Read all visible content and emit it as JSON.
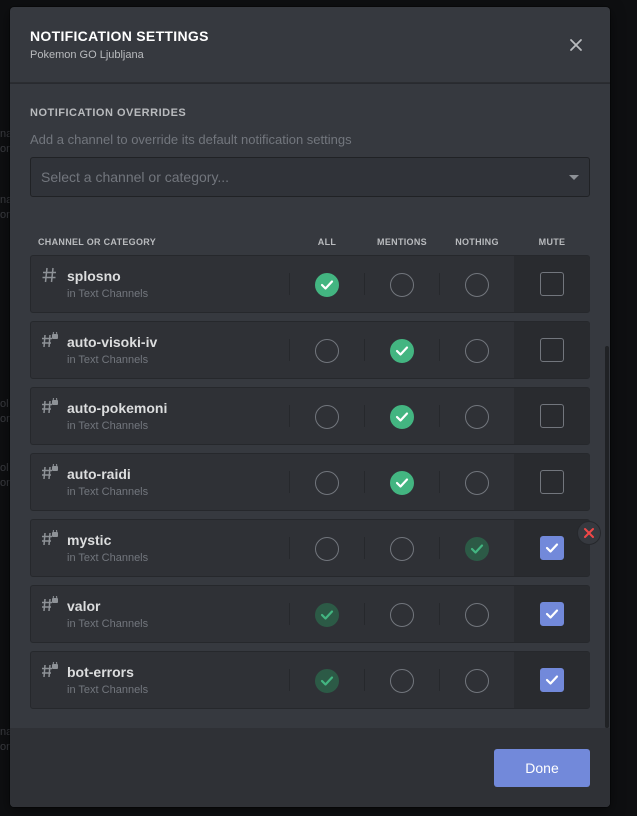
{
  "background": {
    "fragments": [
      "na",
      "on",
      "na",
      "on",
      "ol",
      "on",
      "ol",
      "on",
      "na",
      "on"
    ]
  },
  "modal": {
    "title": "NOTIFICATION SETTINGS",
    "subtitle": "Pokemon GO Ljubljana",
    "close_icon": "close-icon"
  },
  "overrides": {
    "section_title": "NOTIFICATION OVERRIDES",
    "description": "Add a channel to override its default notification settings",
    "select_placeholder": "Select a channel or category..."
  },
  "table": {
    "headers": {
      "channel": "CHANNEL OR CATEGORY",
      "all": "ALL",
      "mentions": "MENTIONS",
      "nothing": "NOTHING",
      "mute": "MUTE"
    },
    "rows": [
      {
        "name": "splosno",
        "category": "in Text Channels",
        "locked": false,
        "setting": "all",
        "muted": false
      },
      {
        "name": "auto-visoki-iv",
        "category": "in Text Channels",
        "locked": true,
        "setting": "mentions",
        "muted": false
      },
      {
        "name": "auto-pokemoni",
        "category": "in Text Channels",
        "locked": true,
        "setting": "mentions",
        "muted": false
      },
      {
        "name": "auto-raidi",
        "category": "in Text Channels",
        "locked": true,
        "setting": "mentions",
        "muted": false
      },
      {
        "name": "mystic",
        "category": "in Text Channels",
        "locked": true,
        "setting": "nothing",
        "muted": true
      },
      {
        "name": "valor",
        "category": "in Text Channels",
        "locked": true,
        "setting": "all",
        "muted": true
      },
      {
        "name": "bot-errors",
        "category": "in Text Channels",
        "locked": true,
        "setting": "all",
        "muted": true
      }
    ]
  },
  "colors": {
    "green": "#43b581",
    "green_dim": "#2c5a46",
    "blurple": "#7289da",
    "red": "#f04747"
  },
  "footer": {
    "done_label": "Done"
  }
}
